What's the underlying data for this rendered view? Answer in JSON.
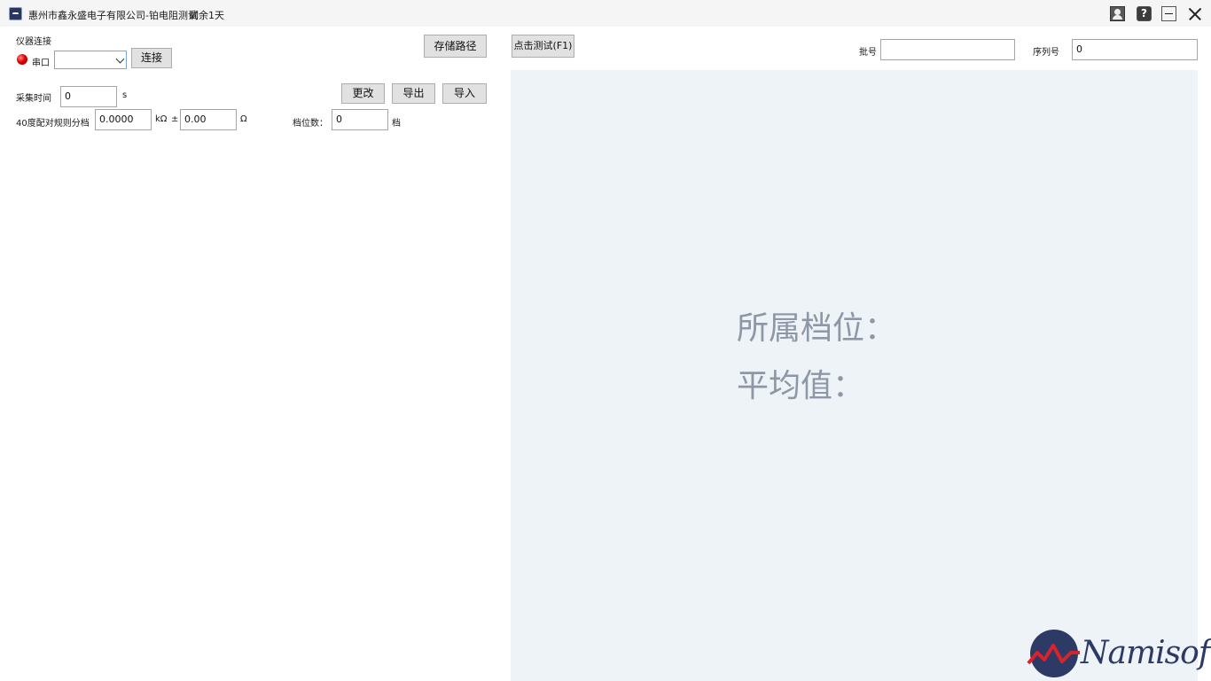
{
  "window": {
    "title": "惠州市鑫永盛电子有限公司-铂电阻测试",
    "remaining": "剩余1天"
  },
  "connection": {
    "section_label": "仪器连接",
    "port_label": "串口",
    "port_value": "",
    "connect_button": "连接",
    "status_color": "#e00000"
  },
  "storage": {
    "path_button": "存储路径"
  },
  "acquisition": {
    "time_label": "采集时间",
    "time_value": "0",
    "time_unit": "s"
  },
  "actions": {
    "change_button": "更改",
    "export_button": "导出",
    "import_button": "导入"
  },
  "grading": {
    "rule_label": "40度配对规则分档",
    "resistance_value": "0.0000",
    "resistance_unit": "kΩ",
    "plusminus": "±",
    "tolerance_value": "0.00",
    "tolerance_unit": "Ω",
    "count_label": "档位数：",
    "count_value": "0",
    "count_unit": "档"
  },
  "test": {
    "test_button": "点击测试(F1)",
    "batch_label": "批号",
    "batch_value": "",
    "serial_label": "序列号",
    "serial_value": "0"
  },
  "result": {
    "grade_label": "所属档位：",
    "average_label": "平均值："
  },
  "logo": {
    "text": "Namisoft"
  }
}
